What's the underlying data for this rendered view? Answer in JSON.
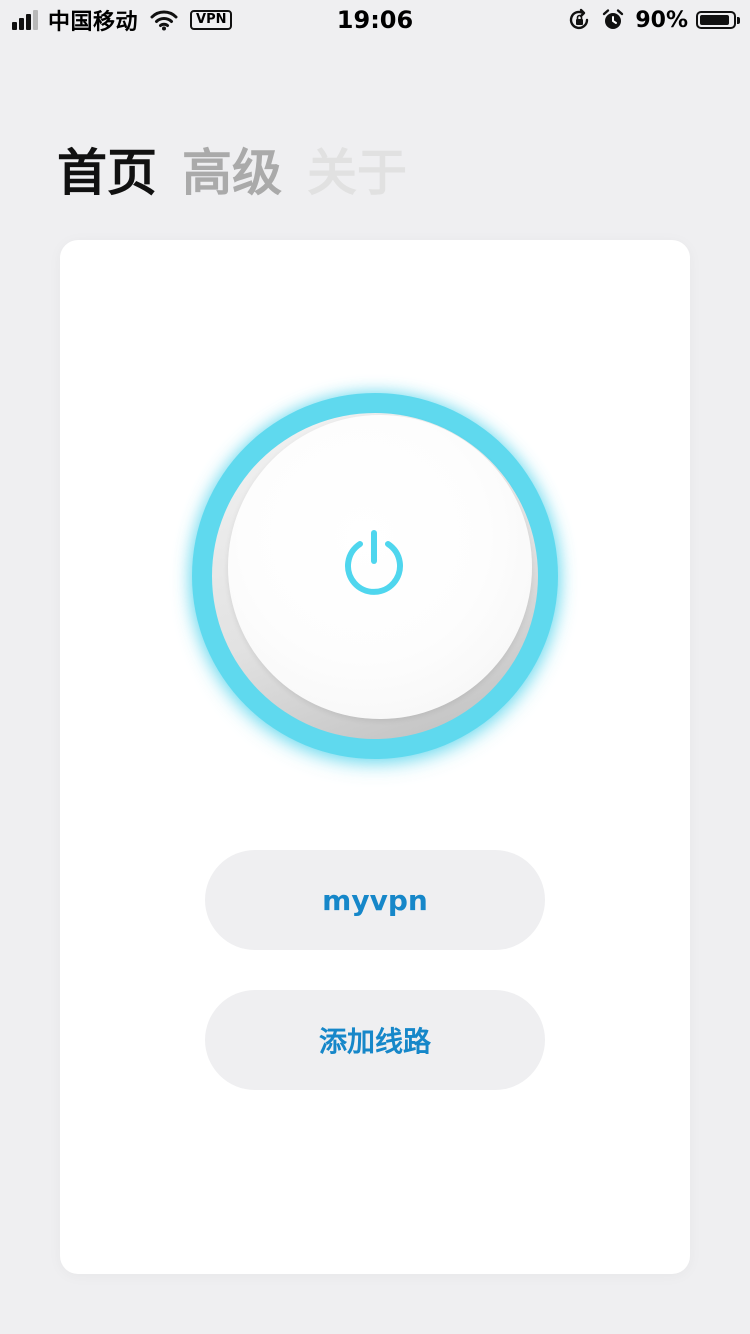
{
  "status_bar": {
    "carrier": "中国移动",
    "vpn_badge": "VPN",
    "time": "19:06",
    "battery_percent": "90%",
    "battery_level": 0.9,
    "icons": [
      "signal-icon",
      "wifi-icon",
      "orientation-lock-icon",
      "alarm-icon",
      "battery-icon"
    ]
  },
  "tabs": [
    {
      "label": "首页",
      "state": "active"
    },
    {
      "label": "高级",
      "state": "inactive"
    },
    {
      "label": "关于",
      "state": "inactive"
    }
  ],
  "main": {
    "power_button": {
      "icon": "power-icon",
      "accent_color": "#5fd9ee"
    },
    "route_button_label": "myvpn",
    "add_route_label": "添加线路",
    "button_text_color": "#1687c9"
  },
  "colors": {
    "background": "#efeff1",
    "card": "#ffffff",
    "accent": "#5fd9ee",
    "link": "#1687c9"
  }
}
